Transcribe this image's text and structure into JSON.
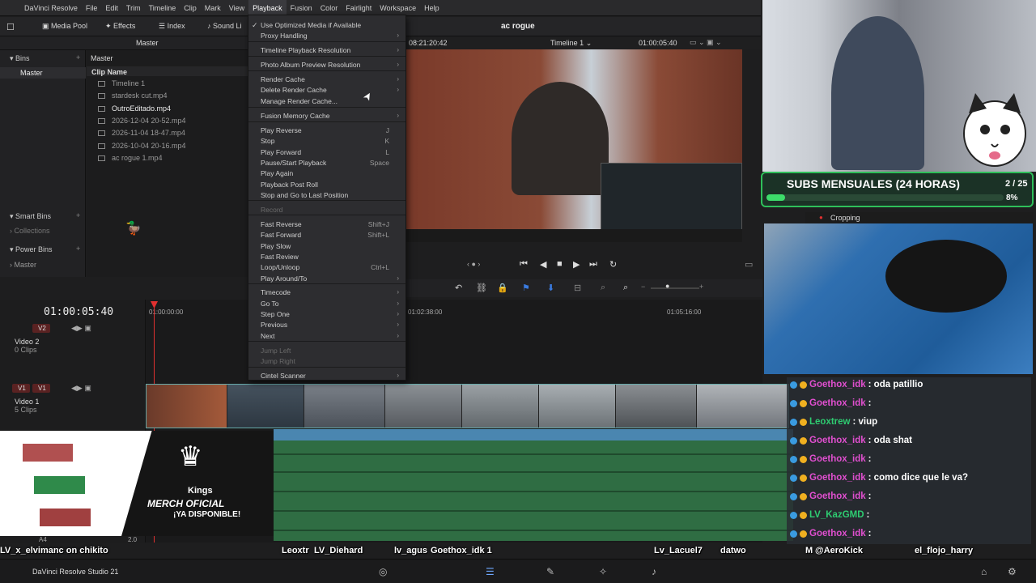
{
  "menubar": {
    "app": "DaVinci Resolve",
    "items": [
      "File",
      "Edit",
      "Trim",
      "Timeline",
      "Clip",
      "Mark",
      "View",
      "Playback",
      "Fusion",
      "Color",
      "Fairlight",
      "Workspace",
      "Help"
    ],
    "active": "Playback"
  },
  "toolbar": {
    "media_pool": "Media Pool",
    "effects": "Effects",
    "index": "Index",
    "sound_library": "Sound Li",
    "project_title": "ac rogue",
    "master": "Master",
    "timecode_left": "08:21:20:42",
    "timeline_name": "Timeline 1",
    "timecode_right": "01:00:05:40"
  },
  "bins": {
    "header": "Bins",
    "master": "Master",
    "smart_bins": "Smart Bins",
    "collections": "Collections",
    "power_bins": "Power Bins",
    "power_master": "Master"
  },
  "pool": {
    "header": "Master",
    "column": "Clip Name",
    "clips": [
      "Timeline 1",
      "stardesk cut.mp4",
      "OutroEditado.mp4",
      "2026-12-04 20-52.mp4",
      "2026-11-04 18-47.mp4",
      "2026-10-04 20-16.mp4",
      "ac rogue 1.mp4"
    ]
  },
  "playback_menu": {
    "items": [
      {
        "label": "Use Optimized Media if Available",
        "checked": true
      },
      {
        "label": "Proxy Handling",
        "submenu": true
      },
      {
        "label": "Timeline Playback Resolution",
        "submenu": true
      },
      {
        "label": "Photo Album Preview Resolution",
        "submenu": true
      },
      {
        "label": "Render Cache",
        "submenu": true
      },
      {
        "label": "Delete Render Cache",
        "submenu": true
      },
      {
        "label": "Manage Render Cache..."
      },
      {
        "label": "Fusion Memory Cache",
        "submenu": true
      },
      {
        "label": "Play Reverse",
        "shortcut": "J"
      },
      {
        "label": "Stop",
        "shortcut": "K"
      },
      {
        "label": "Play Forward",
        "shortcut": "L"
      },
      {
        "label": "Pause/Start Playback",
        "shortcut": "Space"
      },
      {
        "label": "Play Again"
      },
      {
        "label": "Playback Post Roll"
      },
      {
        "label": "Stop and Go to Last Position"
      },
      {
        "label": "Record",
        "disabled": true
      },
      {
        "label": "Fast Reverse",
        "shortcut": "Shift+J"
      },
      {
        "label": "Fast Forward",
        "shortcut": "Shift+L"
      },
      {
        "label": "Play Slow"
      },
      {
        "label": "Fast Review"
      },
      {
        "label": "Loop/Unloop",
        "shortcut": "Ctrl+L"
      },
      {
        "label": "Play Around/To",
        "submenu": true
      },
      {
        "label": "Timecode",
        "submenu": true
      },
      {
        "label": "Go To",
        "submenu": true
      },
      {
        "label": "Step One",
        "submenu": true
      },
      {
        "label": "Previous",
        "submenu": true
      },
      {
        "label": "Next",
        "submenu": true
      },
      {
        "label": "Jump Left",
        "disabled": true
      },
      {
        "label": "Jump Right",
        "disabled": true
      },
      {
        "label": "Cintel Scanner",
        "submenu": true
      }
    ]
  },
  "timeline": {
    "timecode": "01:00:05:40",
    "ruler": [
      "01:00:00:00",
      "01:02:38:00",
      "01:05:16:00"
    ],
    "tracks": [
      {
        "id": "V2",
        "name": "Video 2",
        "clips": "0 Clips"
      },
      {
        "id": "V1",
        "name": "Video 1",
        "clips": "5 Clips"
      },
      {
        "id": "A4",
        "level": "2.0"
      }
    ]
  },
  "overlay": {
    "subs_title": "SUBS MENSUALES (24 HORAS)",
    "subs_count": "2 / 25",
    "subs_percent": "8%",
    "subs_progress": 0.08,
    "cropping": "Cropping",
    "merch_brand": "Kings",
    "merch_line1": "MERCH OFICIAL",
    "merch_line2": "¡YA DISPONIBLE!"
  },
  "chat": [
    {
      "name": "Goethox_idk",
      "msg": ": oda patillio"
    },
    {
      "name": "Goethox_idk",
      "msg": ":"
    },
    {
      "name": "Leoxtrew",
      "msg": ": viup",
      "color": "#2ecc71"
    },
    {
      "name": "Goethox_idk",
      "msg": ": oda shat"
    },
    {
      "name": "Goethox_idk",
      "msg": ":"
    },
    {
      "name": "Goethox_idk",
      "msg": ": como dice que le va?"
    },
    {
      "name": "Goethox_idk",
      "msg": ":"
    },
    {
      "name": "LV_KazGMD",
      "msg": ":",
      "color": "#2ecc71"
    },
    {
      "name": "Goethox_idk",
      "msg": ":"
    }
  ],
  "viewer_names": [
    "LV_x_elvimanc on chikito",
    "Leoxtr",
    "LV_Diehard",
    "lv_agus",
    "Goethox_idk 1",
    "Lv_Lacuel7",
    "datwo",
    "M",
    "@AeroKick",
    "el_flojo_harry"
  ],
  "taskbar": {
    "app_label": "DaVinci Resolve Studio 21"
  }
}
